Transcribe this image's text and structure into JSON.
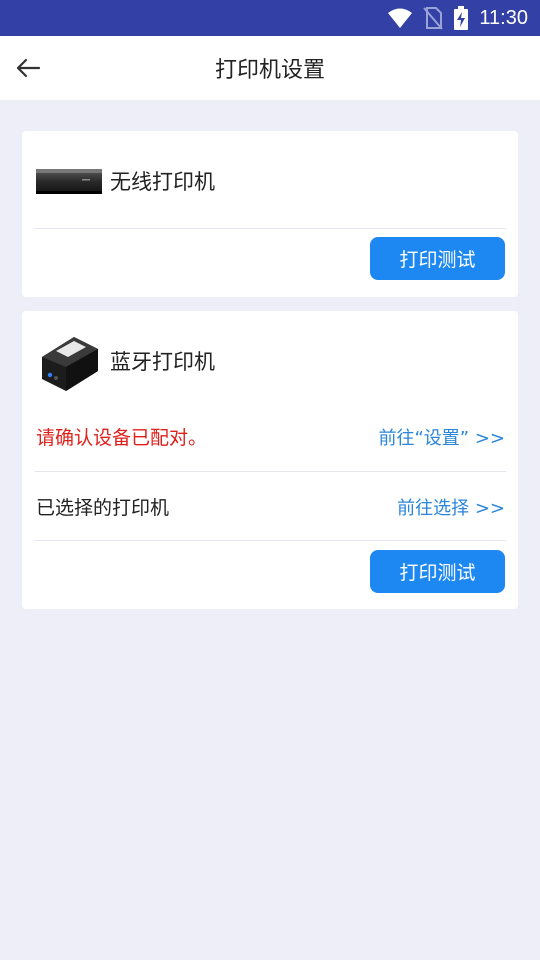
{
  "status_bar": {
    "time": "11:30"
  },
  "app_bar": {
    "title": "打印机设置"
  },
  "wireless": {
    "name": "无线打印机",
    "test_button": "打印测试"
  },
  "bluetooth": {
    "name": "蓝牙打印机",
    "pair_notice": "请确认设备已配对。",
    "settings_link": "前往“设置” >>",
    "selected_label": "已选择的打印机",
    "select_link": "前往选择 >>",
    "test_button": "打印测试"
  },
  "colors": {
    "status_bar": "#3341a6",
    "accent": "#1e88f2",
    "link": "#2a86d9",
    "warning": "#e0201b",
    "background": "#eeeef8"
  }
}
